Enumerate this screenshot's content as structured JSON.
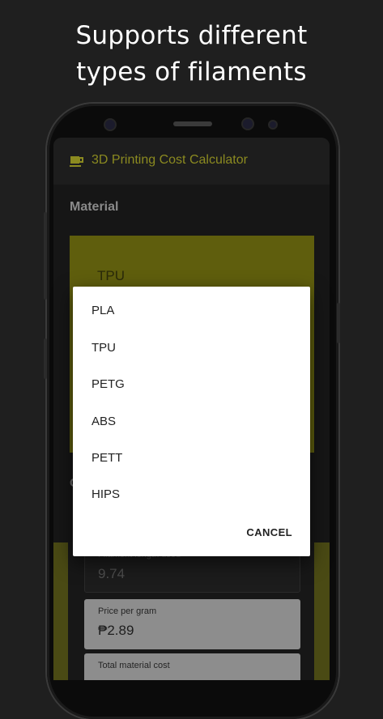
{
  "promo": {
    "line1": "Supports different",
    "line2": "types of filaments"
  },
  "app": {
    "title": "3D Printing Cost Calculator",
    "icon": "cup-icon",
    "accent_color": "#8b8a20"
  },
  "material": {
    "section_label": "Material",
    "selected_value": "TPU"
  },
  "background_fields": {
    "section_initial": "C",
    "filament_length": {
      "label": "Filament length used",
      "value": "9.74"
    },
    "price_per_gram": {
      "label": "Price per gram",
      "value": "₱2.89"
    },
    "total_material_cost": {
      "label": "Total material cost"
    }
  },
  "dialog": {
    "options": [
      "PLA",
      "TPU",
      "PETG",
      "ABS",
      "PETT",
      "HIPS"
    ],
    "cancel_label": "CANCEL"
  }
}
